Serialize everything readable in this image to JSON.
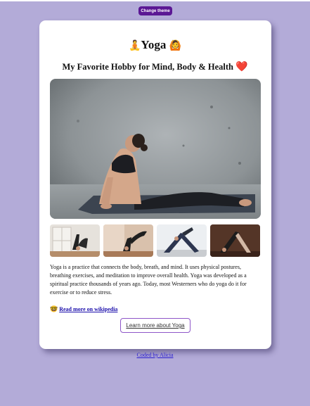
{
  "theme_button": {
    "label": "Change theme"
  },
  "card": {
    "title_text": "Yoga",
    "title_emoji_left": "🧘",
    "title_emoji_right": "🙆",
    "subtitle": "My Favorite Hobby for Mind, Body & Health",
    "subtitle_emoji": "❤️",
    "description": "Yoga is a practice that connects the body, breath, and mind. It uses physical postures, breathing exercises, and meditation to improve overall health. Yoga was developed as a spiritual practice thousands of years ago. Today, most Westerners who do yoga do it for exercise or to reduce stress.",
    "wiki_emoji": "🤓",
    "wiki_link": "Read more on wikipedia",
    "learn_button": "Learn more about Yoga"
  },
  "footer": {
    "link": "Coded by Alicia"
  },
  "colors": {
    "background": "#b3abd8",
    "theme_button": "#5b1794",
    "learn_border": "#8e56c8",
    "link": "#1a0dab"
  }
}
